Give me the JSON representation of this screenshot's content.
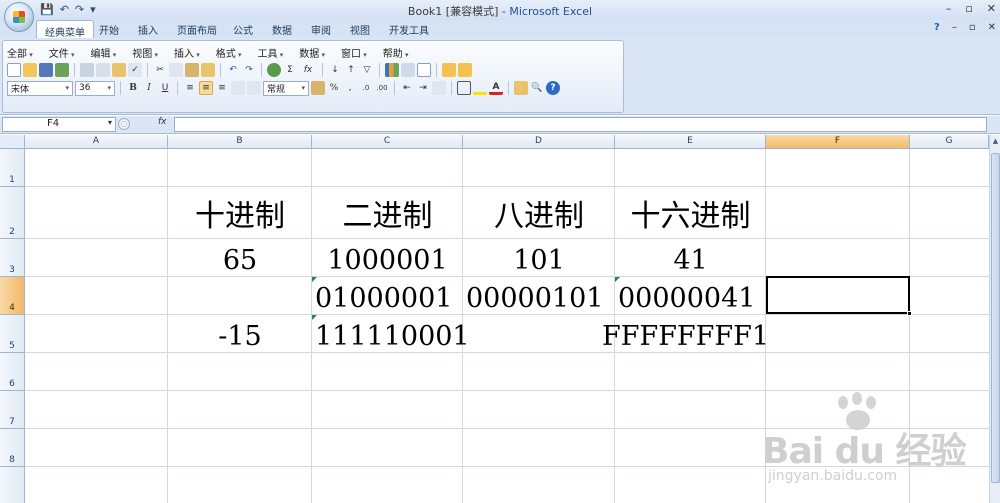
{
  "window": {
    "title_doc": "Book1  [兼容模式]",
    "title_sep": " - ",
    "title_app": "Microsoft Excel",
    "controls": [
      "–",
      "▫",
      "✕"
    ]
  },
  "quick_access": [
    "💾",
    "↶",
    "↷",
    "▾"
  ],
  "ribbon_tabs": [
    "经典菜单",
    "开始",
    "插入",
    "页面布局",
    "公式",
    "数据",
    "审阅",
    "视图",
    "开发工具"
  ],
  "ribbon_right": [
    "?",
    "–",
    "▫",
    "✕"
  ],
  "classic_menu": [
    "全部",
    "文件",
    "编辑",
    "视图",
    "插入",
    "格式",
    "工具",
    "数据",
    "窗口",
    "帮助"
  ],
  "toolbar": {
    "font_name": "宋体",
    "font_size": "36",
    "bold": "B",
    "italic": "I",
    "underline": "U",
    "number_format": "常规",
    "percent": "%",
    "comma": ",",
    "sigma": "Σ",
    "fx": "fx"
  },
  "formula_bar": {
    "name_box": "F4",
    "fx_label": "fx",
    "formula": ""
  },
  "sheet": {
    "columns": [
      "A",
      "B",
      "C",
      "D",
      "E",
      "F",
      "G"
    ],
    "rows": [
      "1",
      "2",
      "3",
      "4",
      "5",
      "6",
      "7",
      "8"
    ],
    "selected_column": "F",
    "selected_row": "4",
    "cells": {
      "B2": "十进制",
      "C2": "二进制",
      "D2": "八进制",
      "E2": "十六进制",
      "B3": "65",
      "C3": "1000001",
      "D3": "101",
      "E3": "41",
      "C4": "01000001",
      "D4": "00000101",
      "E4": "00000041",
      "B5": "-15",
      "C5": "111110001",
      "E5": "FFFFFFFF1"
    }
  },
  "watermark": {
    "text": "Bai du 经验",
    "url": "jingyan.baidu.com"
  }
}
